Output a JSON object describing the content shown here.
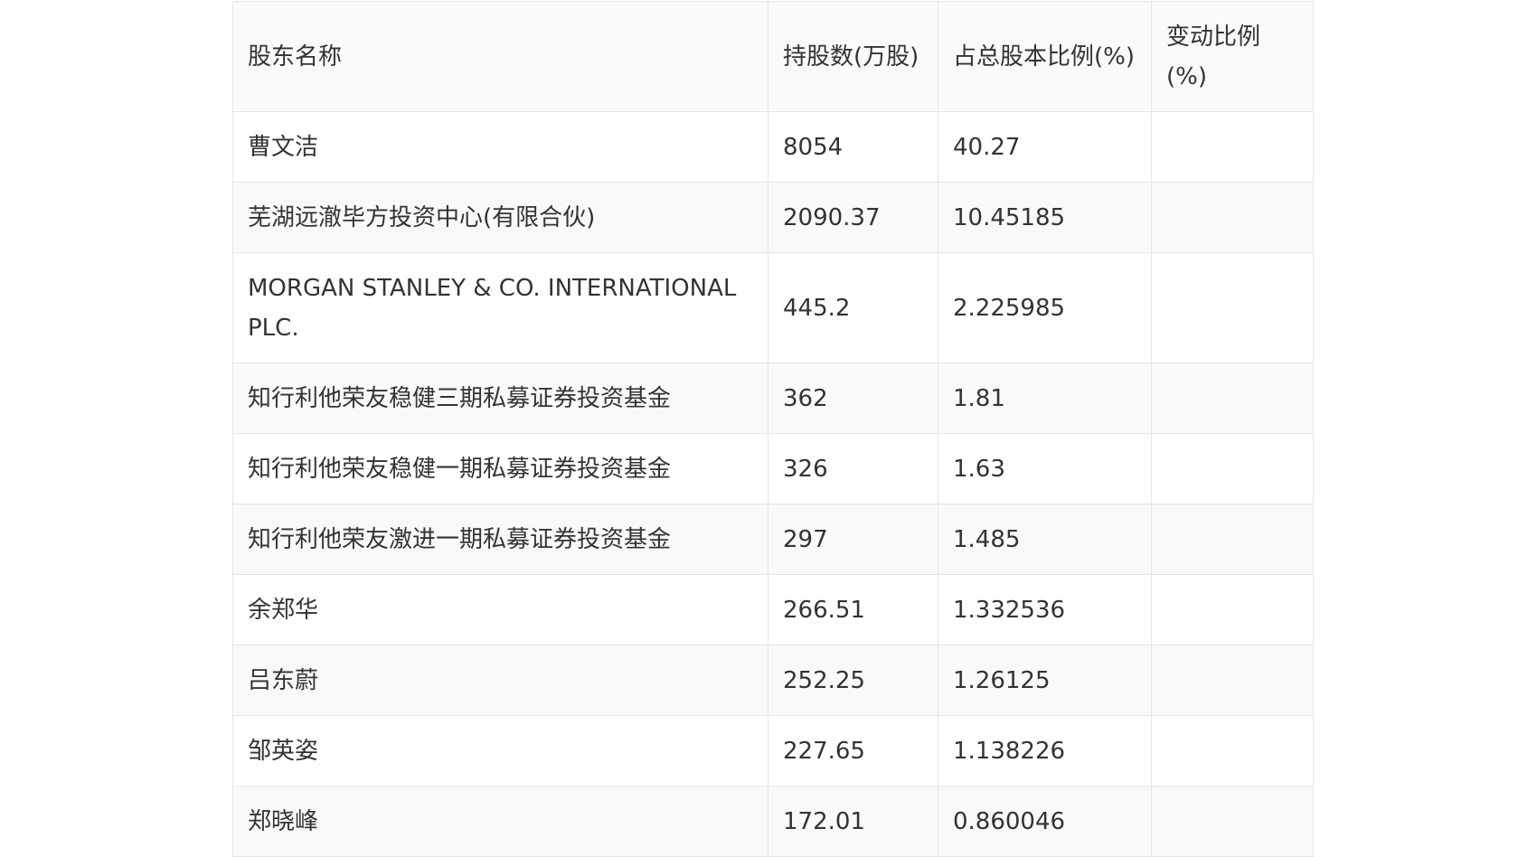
{
  "table": {
    "headers": [
      "股东名称",
      "持股数(万股)",
      "占总股本比例(%)",
      "变动比例(%)"
    ],
    "rows": [
      {
        "name": "曹文洁",
        "shares": "8054",
        "ratio": "40.27",
        "change": ""
      },
      {
        "name": "芜湖远澈毕方投资中心(有限合伙)",
        "shares": "2090.37",
        "ratio": "10.45185",
        "change": ""
      },
      {
        "name": "MORGAN STANLEY & CO. INTERNATIONAL PLC.",
        "shares": "445.2",
        "ratio": "2.225985",
        "change": ""
      },
      {
        "name": "知行利他荣友稳健三期私募证券投资基金",
        "shares": "362",
        "ratio": "1.81",
        "change": ""
      },
      {
        "name": "知行利他荣友稳健一期私募证券投资基金",
        "shares": "326",
        "ratio": "1.63",
        "change": ""
      },
      {
        "name": "知行利他荣友激进一期私募证券投资基金",
        "shares": "297",
        "ratio": "1.485",
        "change": ""
      },
      {
        "name": "余郑华",
        "shares": "266.51",
        "ratio": "1.332536",
        "change": ""
      },
      {
        "name": "吕东蔚",
        "shares": "252.25",
        "ratio": "1.26125",
        "change": ""
      },
      {
        "name": "邹英姿",
        "shares": "227.65",
        "ratio": "1.138226",
        "change": ""
      },
      {
        "name": "郑晓峰",
        "shares": "172.01",
        "ratio": "0.860046",
        "change": ""
      }
    ]
  }
}
